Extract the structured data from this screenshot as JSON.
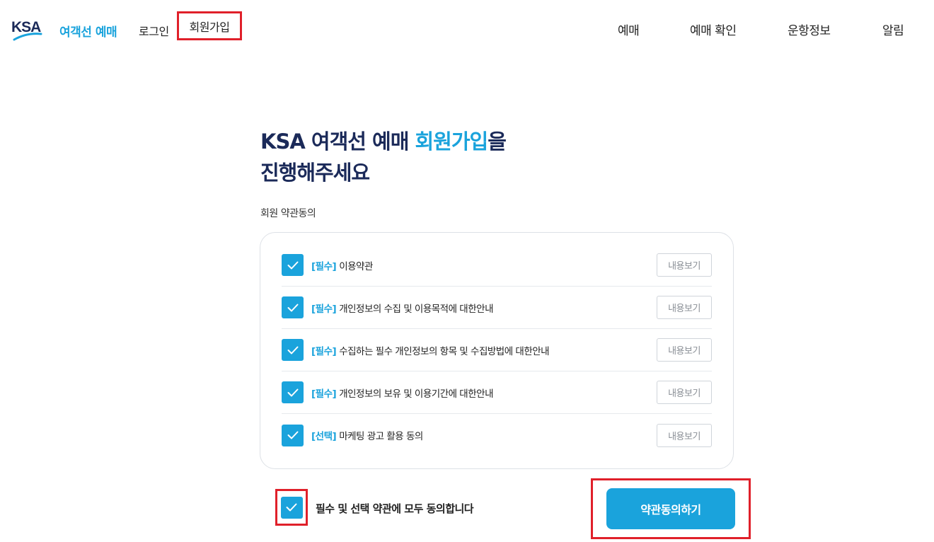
{
  "header": {
    "logo_text": "여객선 예매",
    "nav": {
      "login": "로그인",
      "signup": "회원가입"
    },
    "gnb": [
      "예매",
      "예매 확인",
      "운항정보",
      "알림"
    ]
  },
  "title": {
    "line1_prefix": "KSA 여객선 예매 ",
    "line1_accent": "회원가입",
    "line1_suffix": "을",
    "line2": "진행해주세요"
  },
  "section_label": "회원 약관동의",
  "terms": [
    {
      "tag": "[필수]",
      "text": "이용약관",
      "view": "내용보기",
      "checked": true
    },
    {
      "tag": "[필수]",
      "text": "개인정보의 수집 및 이용목적에 대한안내",
      "view": "내용보기",
      "checked": true
    },
    {
      "tag": "[필수]",
      "text": "수집하는 필수 개인정보의 항목 및 수집방법에 대한안내",
      "view": "내용보기",
      "checked": true
    },
    {
      "tag": "[필수]",
      "text": "개인정보의 보유 및 이용기간에 대한안내",
      "view": "내용보기",
      "checked": true
    },
    {
      "tag": "[선택]",
      "text": "마케팅 광고 활용 동의",
      "view": "내용보기",
      "checked": true
    }
  ],
  "agree_all": {
    "label": "필수 및 선택 약관에 모두 동의합니다",
    "checked": true
  },
  "submit_label": "약관동의하기",
  "colors": {
    "accent": "#1aa3dc",
    "title_navy": "#1b2a59",
    "highlight_red": "#e0202a"
  }
}
